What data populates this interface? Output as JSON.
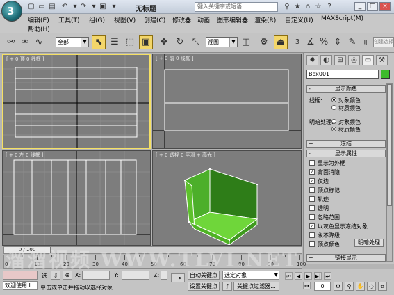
{
  "titlebar": {
    "title": "无标题",
    "search_placeholder": "键入关键字或短语"
  },
  "menu": {
    "items": [
      "编辑(E)",
      "工具(T)",
      "组(G)",
      "视图(V)",
      "创建(C)",
      "修改器",
      "动画",
      "图形编辑器",
      "渲染(R)",
      "自定义(U)",
      "MAXScript(M)",
      "帮助(H)"
    ]
  },
  "toolbar": {
    "selection_filter": "全部",
    "ref_coord": "视图",
    "snap_label": "3",
    "create_selection_set": "创建选择"
  },
  "viewports": [
    {
      "label": "[ + 0 顶 0 线框 ]",
      "active": true
    },
    {
      "label": "[ + 0 前 0 线框 ]",
      "active": false
    },
    {
      "label": "[ + 0 左 0 线框 ]",
      "active": false
    },
    {
      "label": "[ + 0 透视 0 平滑 + 高光 ]",
      "active": false
    }
  ],
  "command_panel": {
    "object_name": "Box001",
    "object_color": "#3dbb2a",
    "display_color_title": "显示颜色",
    "wireframe_label": "线框:",
    "shaded_label": "明暗处理:",
    "option_object_color": "对象颜色",
    "option_material_color": "材质颜色",
    "freeze_title": "冻结",
    "display_props_title": "显示属性",
    "display_props": [
      {
        "label": "显示为外框",
        "checked": false
      },
      {
        "label": "背面消隐",
        "checked": true
      },
      {
        "label": "仅边",
        "checked": true
      },
      {
        "label": "顶点标记",
        "checked": false
      },
      {
        "label": "轨迹",
        "checked": false
      },
      {
        "label": "透明",
        "checked": false
      },
      {
        "label": "忽略范围",
        "checked": false
      },
      {
        "label": "以灰色显示冻结对象",
        "checked": true
      },
      {
        "label": "永不降级",
        "checked": false
      },
      {
        "label": "顶点颜色",
        "checked": false
      }
    ],
    "shaded_button": "明暗处理",
    "link_display_title": "链接显示"
  },
  "timeline": {
    "frame_display": "0 / 100",
    "ticks": [
      "0",
      "10",
      "20",
      "30",
      "40",
      "50",
      "60",
      "70",
      "80",
      "90",
      "100"
    ]
  },
  "statusbar": {
    "maxscript_listener": "欢迎使用 I",
    "selection_label": "选",
    "x_label": "X:",
    "y_label": "Y:",
    "z_label": "Z:",
    "auto_key": "自动关键点",
    "set_key": "设置关键点",
    "selected_object": "选定对象",
    "key_filters": "关键点过滤器...",
    "prompt": "单击或单击并拖动以选择对象",
    "frame_number": "0"
  },
  "watermark": "溜溜视频 WWW.TLVI.NET"
}
